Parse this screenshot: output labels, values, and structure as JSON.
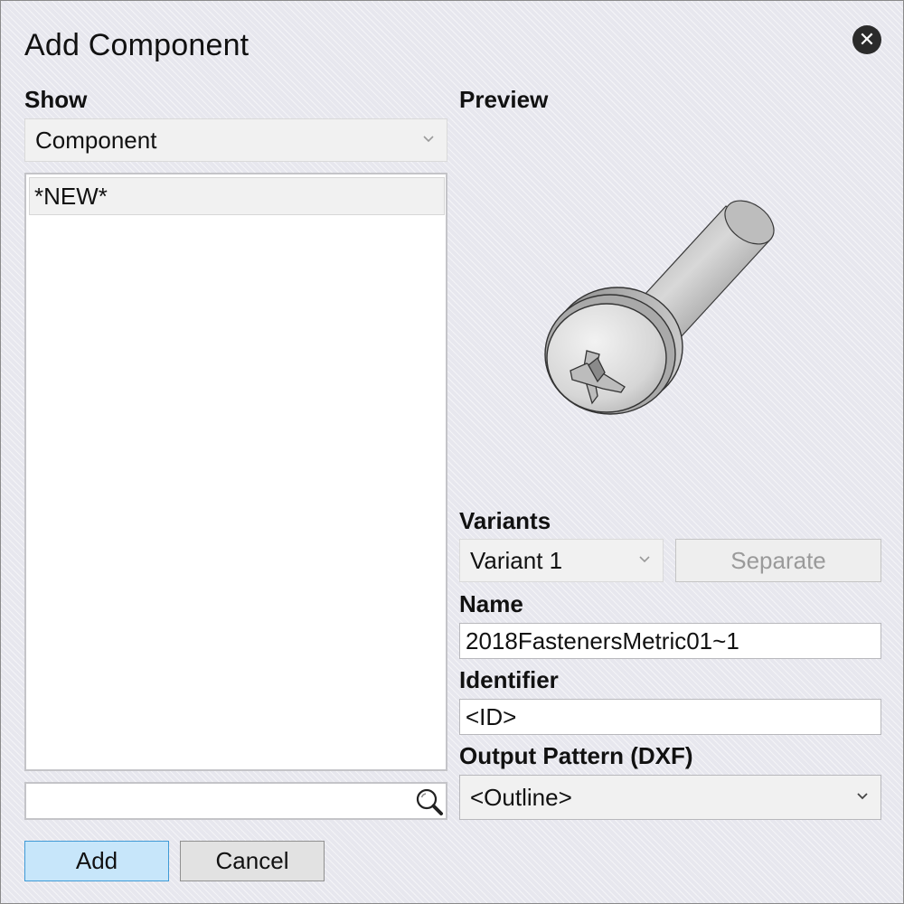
{
  "dialog": {
    "title": "Add Component",
    "close_icon": "close-icon"
  },
  "show": {
    "label": "Show",
    "selected": "Component"
  },
  "list": {
    "items": [
      "*NEW*"
    ]
  },
  "search": {
    "value": "",
    "icon": "magnifier-icon"
  },
  "preview": {
    "label": "Preview",
    "image": "screw-3d-preview"
  },
  "variants": {
    "label": "Variants",
    "selected": "Variant 1",
    "separate_label": "Separate"
  },
  "name": {
    "label": "Name",
    "value": "2018FastenersMetric01~1"
  },
  "identifier": {
    "label": "Identifier",
    "value": "<ID>"
  },
  "output_pattern": {
    "label": "Output Pattern (DXF)",
    "selected": "<Outline>"
  },
  "buttons": {
    "add_label": "Add",
    "cancel_label": "Cancel"
  },
  "colors": {
    "primary_button_bg": "#c7e6fa",
    "primary_button_border": "#3f9ad6"
  }
}
